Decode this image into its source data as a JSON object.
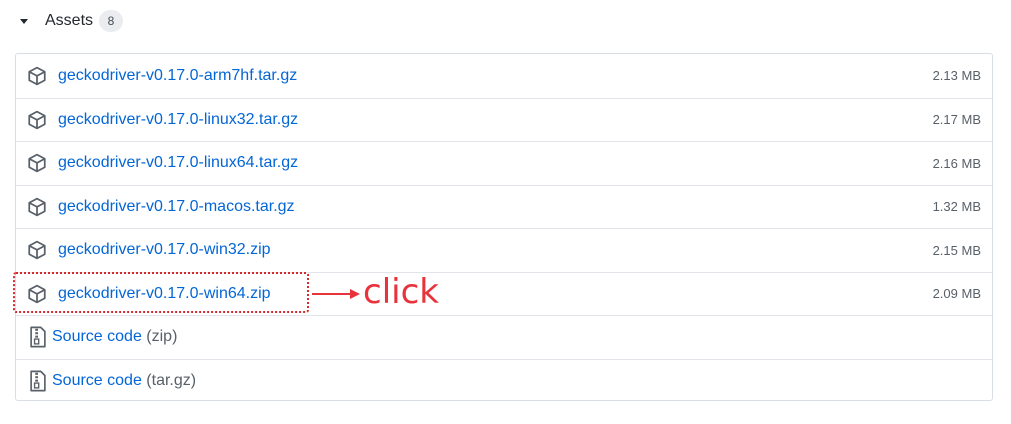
{
  "assets": {
    "title": "Assets",
    "count": "8"
  },
  "files": [
    {
      "name": "geckodriver-v0.17.0-arm7hf.tar.gz",
      "size": "2.13 MB"
    },
    {
      "name": "geckodriver-v0.17.0-linux32.tar.gz",
      "size": "2.17 MB"
    },
    {
      "name": "geckodriver-v0.17.0-linux64.tar.gz",
      "size": "2.16 MB"
    },
    {
      "name": "geckodriver-v0.17.0-macos.tar.gz",
      "size": "1.32 MB"
    },
    {
      "name": "geckodriver-v0.17.0-win32.zip",
      "size": "2.15 MB"
    },
    {
      "name": "geckodriver-v0.17.0-win64.zip",
      "size": "2.09 MB"
    }
  ],
  "sources": [
    {
      "label": "Source code",
      "ext": "(zip)"
    },
    {
      "label": "Source code",
      "ext": "(tar.gz)"
    }
  ],
  "annotation": {
    "text": "click",
    "color": "#e8323c"
  },
  "colors": {
    "link": "#0366d6",
    "muted": "#586069",
    "border": "#e1e4e8"
  },
  "icons": {
    "asset": "package-icon",
    "source": "file-zip-icon"
  }
}
